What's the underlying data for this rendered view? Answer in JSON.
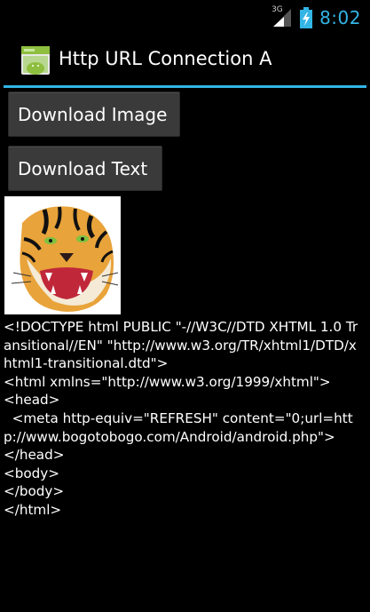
{
  "status_bar": {
    "network_label": "3G",
    "time": "8:02",
    "signal_icon": "signal-icon",
    "battery_icon": "battery-charging-icon"
  },
  "action_bar": {
    "title": "Http URL Connection A",
    "icon": "android-app-icon",
    "accent_color": "#33b5e5"
  },
  "buttons": {
    "download_image": "Download Image",
    "download_text": "Download Text"
  },
  "image": {
    "icon": "tiger-image"
  },
  "output": {
    "text": "<!DOCTYPE html PUBLIC \"-//W3C//DTD XHTML 1.0 Transitional//EN\" \"http://www.w3.org/TR/xhtml1/DTD/xhtml1-transitional.dtd\">\n<html xmlns=\"http://www.w3.org/1999/xhtml\">\n<head>\n  <meta http-equiv=\"REFRESH\" content=\"0;url=http://www.bogotobogo.com/Android/android.php\">\n</head>\n<body>\n</body>\n</html>"
  }
}
